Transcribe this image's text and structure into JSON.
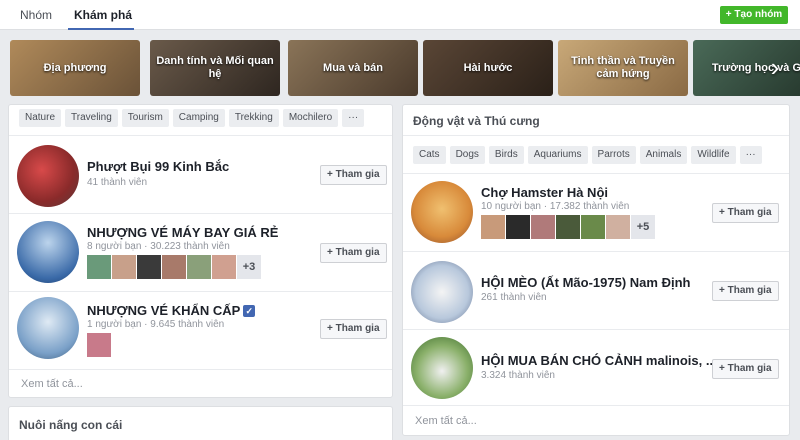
{
  "nav": {
    "tabs": [
      {
        "label": "Nhóm"
      },
      {
        "label": "Khám phá"
      }
    ],
    "create_button": "+ Tạo nhóm"
  },
  "categories": [
    {
      "label": "Địa phương",
      "color": "#8a6a4a"
    },
    {
      "label": "Danh tính và Mối quan hệ",
      "color": "#5a4a3a"
    },
    {
      "label": "Mua và bán",
      "color": "#6b5a48"
    },
    {
      "label": "Hài hước",
      "color": "#4a3a2c"
    },
    {
      "label": "Tinh thần và Truyền cảm hứng",
      "color": "#a0845c"
    },
    {
      "label": "Trường học và Gi",
      "color": "#3f5a4a"
    }
  ],
  "left_panel": {
    "chips": [
      "Nature",
      "Traveling",
      "Tourism",
      "Camping",
      "Trekking",
      "Mochilero",
      "···"
    ],
    "groups": [
      {
        "name": "Phượt Bụi 99 Kinh Bắc",
        "meta": "41 thành viên",
        "join": "+ Tham gia",
        "thumbs": [],
        "more": ""
      },
      {
        "name": "NHƯỢNG VÉ MÁY BAY GIÁ RẺ",
        "meta": "8 người bạn · 30.223 thành viên",
        "join": "+ Tham gia",
        "thumbs": [
          "#6a9a7a",
          "#c8a08a",
          "#3a3a3a",
          "#a87a6a",
          "#8aa07a",
          "#d0a090"
        ],
        "more": "+3"
      },
      {
        "name": "NHƯỢNG VÉ KHẨN CẤP",
        "meta": "1 người bạn · 9.645 thành viên",
        "join": "+ Tham gia",
        "thumbs": [
          "#c87a8a"
        ],
        "more": ""
      }
    ],
    "see_all": "Xem tất cả..."
  },
  "left_panel_2": {
    "title": "Nuôi nấng con cái"
  },
  "right_panel": {
    "title": "Động vật và Thú cưng",
    "chips": [
      "Cats",
      "Dogs",
      "Birds",
      "Aquariums",
      "Parrots",
      "Animals",
      "Wildlife",
      "···"
    ],
    "groups": [
      {
        "name": "Chợ Hamster Hà Nội",
        "meta": "10 người bạn · 17.382 thành viên",
        "join": "+ Tham gia",
        "thumbs": [
          "#c89a7a",
          "#2a2a2a",
          "#b07a7a",
          "#4a5a3a",
          "#6a8a4a",
          "#d0b0a0"
        ],
        "more": "+5"
      },
      {
        "name": "HỘI MÈO (Ất Mão-1975) Nam Định",
        "meta": "261 thành viên",
        "join": "+ Tham gia",
        "thumbs": [],
        "more": ""
      },
      {
        "name": "HỘI MUA BÁN CHÓ CẢNH malinois, ...",
        "meta": "3.324 thành viên",
        "join": "+ Tham gia",
        "thumbs": [],
        "more": ""
      }
    ],
    "see_all": "Xem tất cả..."
  }
}
